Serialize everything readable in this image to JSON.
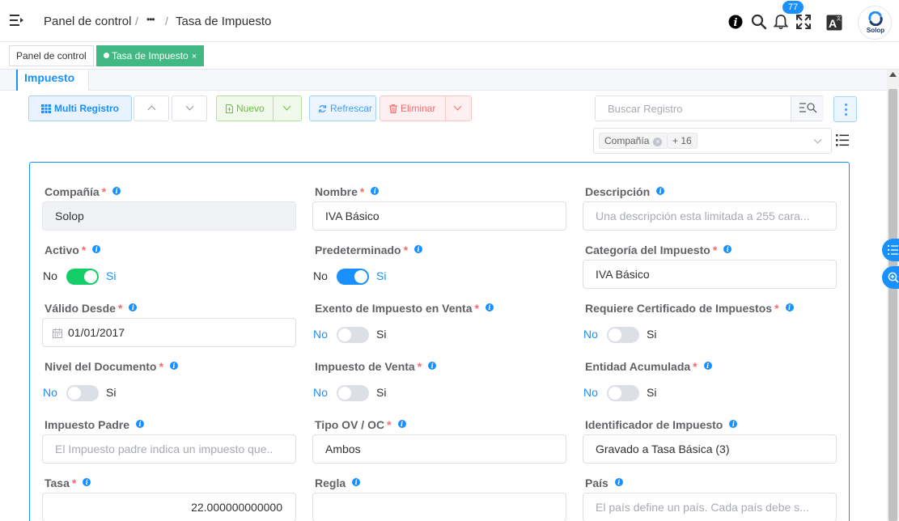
{
  "header": {
    "breadcrumb": {
      "home": "Panel de control",
      "ellipsis": "•••",
      "current": "Tasa de Impuesto",
      "separator": "/"
    },
    "notifications_count": "77",
    "icons": [
      "menu-fold-icon",
      "info-icon",
      "search-icon",
      "bell-icon",
      "fullscreen-icon",
      "translate-icon"
    ],
    "avatar_label": "Solop"
  },
  "tags": [
    {
      "label": "Panel de control",
      "active": false
    },
    {
      "label": "Tasa de Impuesto",
      "active": true,
      "close": "×"
    }
  ],
  "tab": {
    "label": "Impuesto"
  },
  "toolbar": {
    "multi_label": "Multi Registro",
    "new_label": "Nuevo",
    "refresh_label": "Refrescar",
    "delete_label": "Eliminar",
    "search_placeholder": "Buscar Registro",
    "columns_chip": "Compañía",
    "columns_more": "+ 16"
  },
  "form": {
    "company": {
      "label": "Compañía",
      "value": "Solop",
      "required": "*"
    },
    "name": {
      "label": "Nombre",
      "value": "IVA Básico",
      "required": "*"
    },
    "description": {
      "label": "Descripción",
      "placeholder": "Una descripción esta limitada a 255 cara..."
    },
    "active": {
      "label": "Activo",
      "required": "*",
      "no": "No",
      "yes": "Si",
      "value": true
    },
    "default": {
      "label": "Predeterminado",
      "required": "*",
      "no": "No",
      "yes": "Si",
      "value": true
    },
    "tax_category": {
      "label": "Categoría del Impuesto",
      "required": "*",
      "value": "IVA Básico"
    },
    "valid_from": {
      "label": "Válido Desde",
      "required": "*",
      "value": "01/01/2017"
    },
    "sales_exempt": {
      "label": "Exento de Impuesto en Venta",
      "required": "*",
      "no": "No",
      "yes": "Si",
      "value": false
    },
    "requires_cert": {
      "label": "Requiere Certificado de Impuestos",
      "required": "*",
      "no": "No",
      "yes": "Si",
      "value": false
    },
    "doc_level": {
      "label": "Nivel del Documento",
      "required": "*",
      "no": "No",
      "yes": "Si",
      "value": false
    },
    "sales_tax": {
      "label": "Impuesto de Venta",
      "required": "*",
      "no": "No",
      "yes": "Si",
      "value": false
    },
    "accumulated": {
      "label": "Entidad Acumulada",
      "required": "*",
      "no": "No",
      "yes": "Si",
      "value": false
    },
    "parent_tax": {
      "label": "Impuesto Padre",
      "placeholder": "El Impuesto padre indica un impuesto que.."
    },
    "so_po_type": {
      "label": "Tipo OV / OC",
      "required": "*",
      "value": "Ambos"
    },
    "tax_identifier": {
      "label": "Identificador de Impuesto",
      "value": "Gravado a Tasa Básica (3)"
    },
    "rate": {
      "label": "Tasa",
      "required": "*",
      "value": "22.000000000000"
    },
    "rule": {
      "label": "Regla",
      "value": ""
    },
    "country": {
      "label": "País",
      "placeholder": "El país define un país. Cada país debe s..."
    }
  },
  "colors": {
    "primary": "#1890ff",
    "switch_on_green": "#13ce66",
    "switch_on_blue": "#1890ff",
    "switch_off": "#dcdfe6",
    "tag_active": "#42b983",
    "required": "#f56c6c"
  }
}
